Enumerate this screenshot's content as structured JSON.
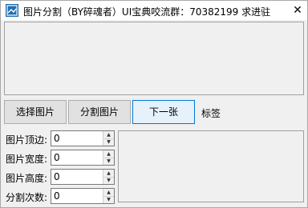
{
  "window": {
    "title": "图片分割（BY碎魂者）UI宝典咬流群：70382199 求进驻",
    "close_glyph": "✕"
  },
  "toolbar": {
    "select_label": "选择图片",
    "split_label": "分割图片",
    "next_label": "下一张",
    "tag_label": "标签"
  },
  "fields": [
    {
      "label": "图片顶边:",
      "value": "0"
    },
    {
      "label": "图片宽度:",
      "value": "0"
    },
    {
      "label": "图片高度:",
      "value": "0"
    },
    {
      "label": "分割次数:",
      "value": "0"
    }
  ],
  "icons": {
    "app": "app-logo-icon",
    "spin_up": "▲",
    "spin_down": "▼"
  },
  "colors": {
    "focus_border": "#0078d7",
    "button_bg": "#e1e1e1"
  }
}
